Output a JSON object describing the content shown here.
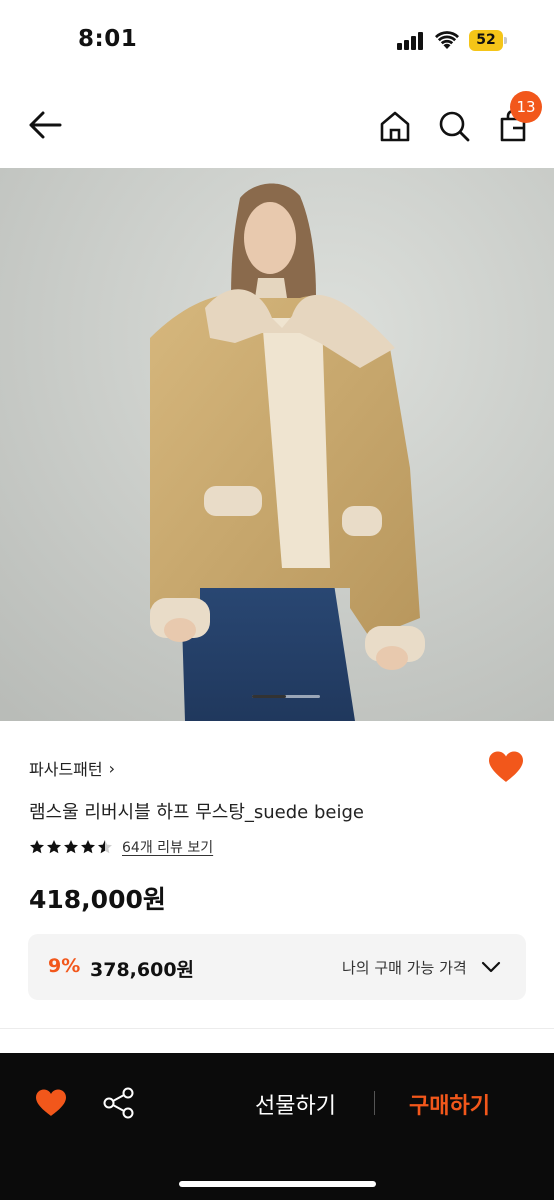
{
  "status_bar": {
    "time": "8:01",
    "battery": "52",
    "battery_color": "#f5c518"
  },
  "nav": {
    "back_icon": "arrow-left-icon",
    "home_icon": "home-icon",
    "search_icon": "search-icon",
    "cart_icon": "shopping-bag-icon",
    "cart_count": "13"
  },
  "gallery": {
    "total_images": 2,
    "active_index": 0
  },
  "product": {
    "brand": "파사드패턴",
    "brand_chevron": "›",
    "name": "램스울 리버시블 하프 무스탕_suede beige",
    "rating": 4.5,
    "review_link": "64개 리뷰 보기",
    "price": "418,000원",
    "wishlisted": true
  },
  "deal": {
    "discount": "9%",
    "price": "378,600원",
    "label": "나의 구매 가능 가격"
  },
  "bottom_bar": {
    "gift_label": "선물하기",
    "buy_label": "구매하기",
    "heart_icon": "heart-icon",
    "share_icon": "share-icon"
  },
  "colors": {
    "accent": "#f2571b",
    "bottom_bar": "#0b0b0b",
    "deal_box": "#f4f4f4"
  }
}
